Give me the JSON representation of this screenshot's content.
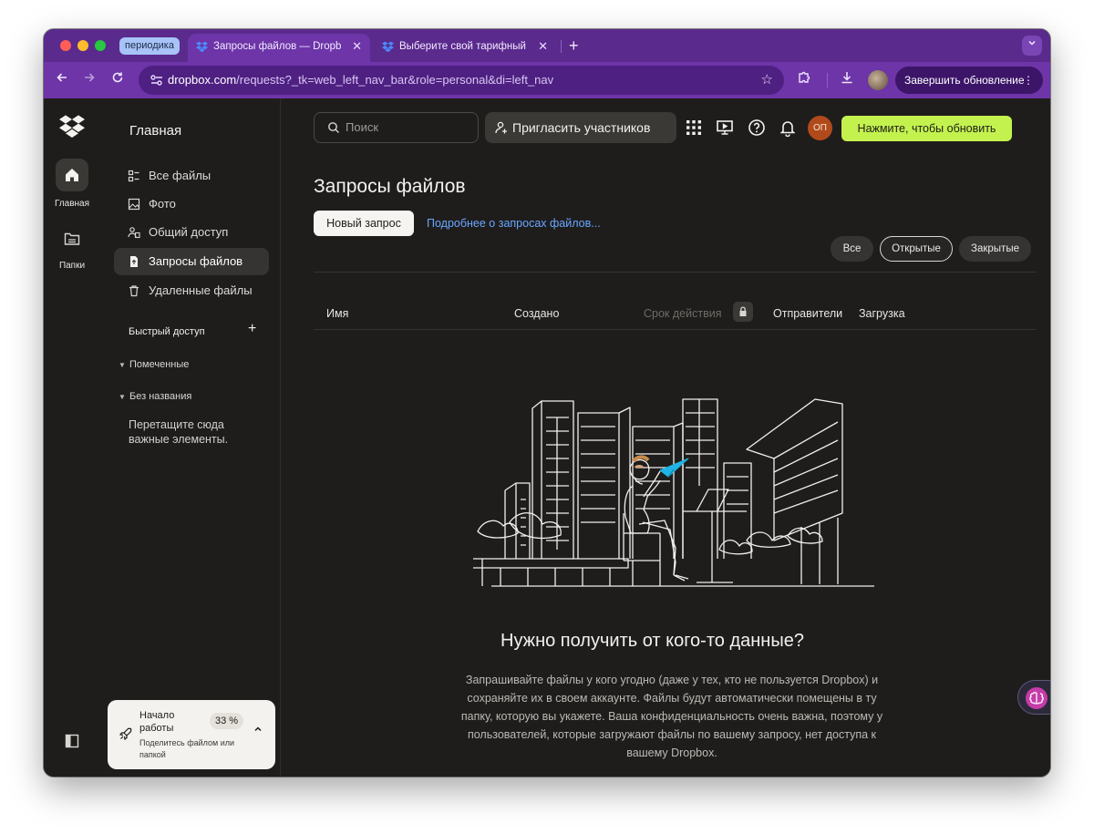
{
  "browser": {
    "tab_group_label": "периодика",
    "tabs": [
      {
        "title": "Запросы файлов — Dropbox",
        "favicon": "dropbox-icon",
        "close": "✕"
      },
      {
        "title": "Выберите свой тарифный п",
        "favicon": "dropbox-icon",
        "close": "✕"
      }
    ],
    "new_tab": "+",
    "url_host": "dropbox.com",
    "url_path": "/requests?_tk=web_left_nav_bar&role=personal&di=left_nav",
    "update_button": "Завершить обновление",
    "update_menu": "⋮",
    "colors": {
      "frame": "#5a2a8c",
      "toolbar": "#6d35a8",
      "omnibox": "#4e2082"
    }
  },
  "rail": {
    "home_label": "Главная",
    "folders_label": "Папки"
  },
  "nav": {
    "title": "Главная",
    "items": [
      {
        "label": "Все файлы",
        "icon": "all-files-icon",
        "active": false
      },
      {
        "label": "Фото",
        "icon": "photo-icon",
        "active": false
      },
      {
        "label": "Общий доступ",
        "icon": "shared-icon",
        "active": false
      },
      {
        "label": "Запросы файлов",
        "icon": "file-request-icon",
        "active": true
      },
      {
        "label": "Удаленные файлы",
        "icon": "trash-icon",
        "active": false
      }
    ],
    "quick_access": "Быстрый доступ",
    "quick_add": "+",
    "groups": [
      "Помеченные",
      "Без названия"
    ],
    "drop_hint": "Перетащите сюда важные элементы."
  },
  "onboarding": {
    "title": "Начало работы",
    "percent": "33 %",
    "progress": 0.33,
    "subtitle": "Поделитесь файлом или папкой"
  },
  "header": {
    "search_placeholder": "Поиск",
    "invite_label": "Пригласить участников",
    "avatar_initials": "ОП",
    "upgrade_label": "Нажмите, чтобы обновить",
    "accent": "#c3f24e"
  },
  "page": {
    "title": "Запросы файлов",
    "new_request": "Новый запрос",
    "learn_more": "Подробнее о запросах файлов...",
    "filters": [
      {
        "label": "Все",
        "active": false
      },
      {
        "label": "Открытые",
        "active": true
      },
      {
        "label": "Закрытые",
        "active": false
      }
    ],
    "columns": [
      "Имя",
      "Создано",
      "Срок действия",
      "Отправители",
      "Загрузка"
    ],
    "empty_title": "Нужно получить от кого-то данные?",
    "empty_desc": "Запрашивайте файлы у кого угодно (даже у тех, кто не пользуется Dropbox) и сохраняйте их в своем аккаунте. Файлы будут автоматически помещены в ту папку, которую вы укажете. Ваша конфиденциальность очень важна, поэтому у пользователей, которые загружают файлы по вашему запросу, нет доступа к вашему Dropbox."
  }
}
